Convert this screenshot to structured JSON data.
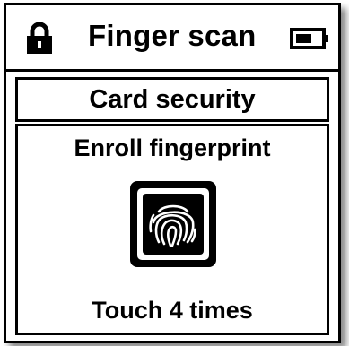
{
  "header": {
    "title": "Finger scan",
    "left_icon": "lock-icon",
    "right_icon": "battery-icon"
  },
  "card_security": {
    "label": "Card security"
  },
  "enroll": {
    "title": "Enroll fingerprint",
    "icon": "fingerprint-icon",
    "instruction": "Touch 4 times"
  },
  "colors": {
    "foreground": "#000000",
    "background": "#ffffff"
  }
}
